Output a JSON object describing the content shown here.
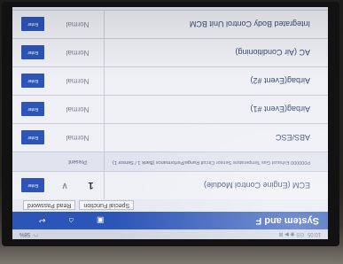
{
  "status_bar": {
    "time": "10:05",
    "left_info": "GS ◉ ▶ ⊞",
    "right_info": "58%"
  },
  "header": {
    "title": "System and F"
  },
  "tabs": [
    {
      "label": "Special Function"
    },
    {
      "label": "Read Password"
    }
  ],
  "systems": [
    {
      "name": "ECM (Engine Control Module)",
      "status": "1",
      "button": "Enter",
      "fault": true
    },
    {
      "name": "P000000 Exhaust Gas Temperature Sensor Circuit Range/Performance (Bank 1 / Sensor 1)",
      "status": "Present",
      "sub": true
    },
    {
      "name": "ABS/ESC",
      "status": "Normal",
      "button": "Enter"
    },
    {
      "name": "Airbag(Event #1)",
      "status": "Normal",
      "button": "Enter"
    },
    {
      "name": "Airbag(Event #2)",
      "status": "Normal",
      "button": "Enter"
    },
    {
      "name": "AC (Air Conditioning)",
      "status": "Normal",
      "button": "Enter"
    },
    {
      "name": "Integrated Body Control Unit BCM",
      "status": "Normal",
      "button": "Enter"
    }
  ],
  "colors": {
    "accent": "#2d55b8",
    "screen_bg": "#e6e9f2"
  }
}
